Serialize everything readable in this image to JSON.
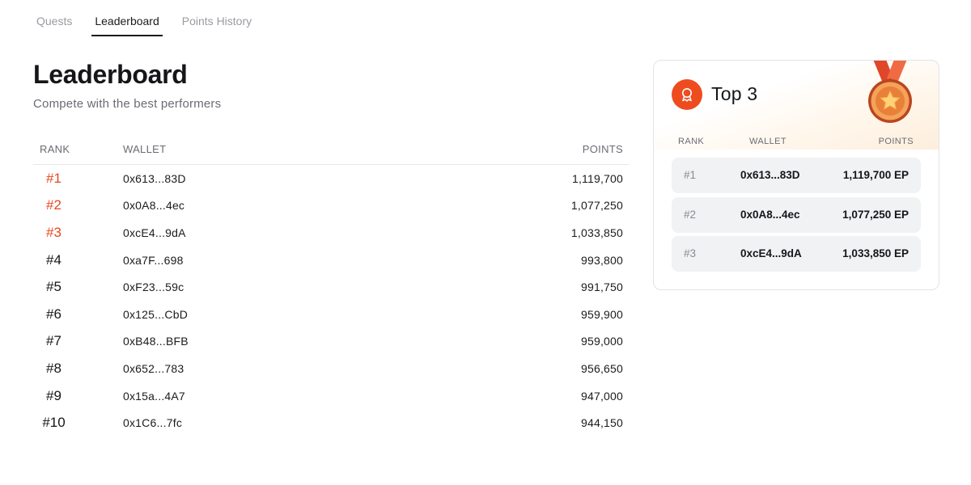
{
  "tabs": [
    {
      "label": "Quests"
    },
    {
      "label": "Leaderboard"
    },
    {
      "label": "Points History"
    }
  ],
  "header": {
    "title": "Leaderboard",
    "subtitle": "Compete with the best performers"
  },
  "table": {
    "columns": {
      "rank": "RANK",
      "wallet": "WALLET",
      "points": "POINTS"
    },
    "rows": [
      {
        "rank": "#1",
        "wallet": "0x613...83D",
        "points": "1,119,700"
      },
      {
        "rank": "#2",
        "wallet": "0x0A8...4ec",
        "points": "1,077,250"
      },
      {
        "rank": "#3",
        "wallet": "0xcE4...9dA",
        "points": "1,033,850"
      },
      {
        "rank": "#4",
        "wallet": "0xa7F...698",
        "points": "993,800"
      },
      {
        "rank": "#5",
        "wallet": "0xF23...59c",
        "points": "991,750"
      },
      {
        "rank": "#6",
        "wallet": "0x125...CbD",
        "points": "959,900"
      },
      {
        "rank": "#7",
        "wallet": "0xB48...BFB",
        "points": "959,000"
      },
      {
        "rank": "#8",
        "wallet": "0x652...783",
        "points": "956,650"
      },
      {
        "rank": "#9",
        "wallet": "0x15a...4A7",
        "points": "947,000"
      },
      {
        "rank": "#10",
        "wallet": "0x1C6...7fc",
        "points": "944,150"
      }
    ]
  },
  "top3": {
    "title": "Top 3",
    "icon": "award-ribbon-icon",
    "medal_icon": "star-medal-icon",
    "columns": {
      "rank": "RANK",
      "wallet": "WALLET",
      "points": "POINTS"
    },
    "rows": [
      {
        "rank": "#1",
        "wallet": "0x613...83D",
        "points": "1,119,700 EP"
      },
      {
        "rank": "#2",
        "wallet": "0x0A8...4ec",
        "points": "1,077,250 EP"
      },
      {
        "rank": "#3",
        "wallet": "0xcE4...9dA",
        "points": "1,033,850 EP"
      }
    ]
  },
  "colors": {
    "accent": "#e9471e",
    "text": "#16161a",
    "muted": "#6b6b74",
    "row_bg": "#f1f2f4"
  }
}
